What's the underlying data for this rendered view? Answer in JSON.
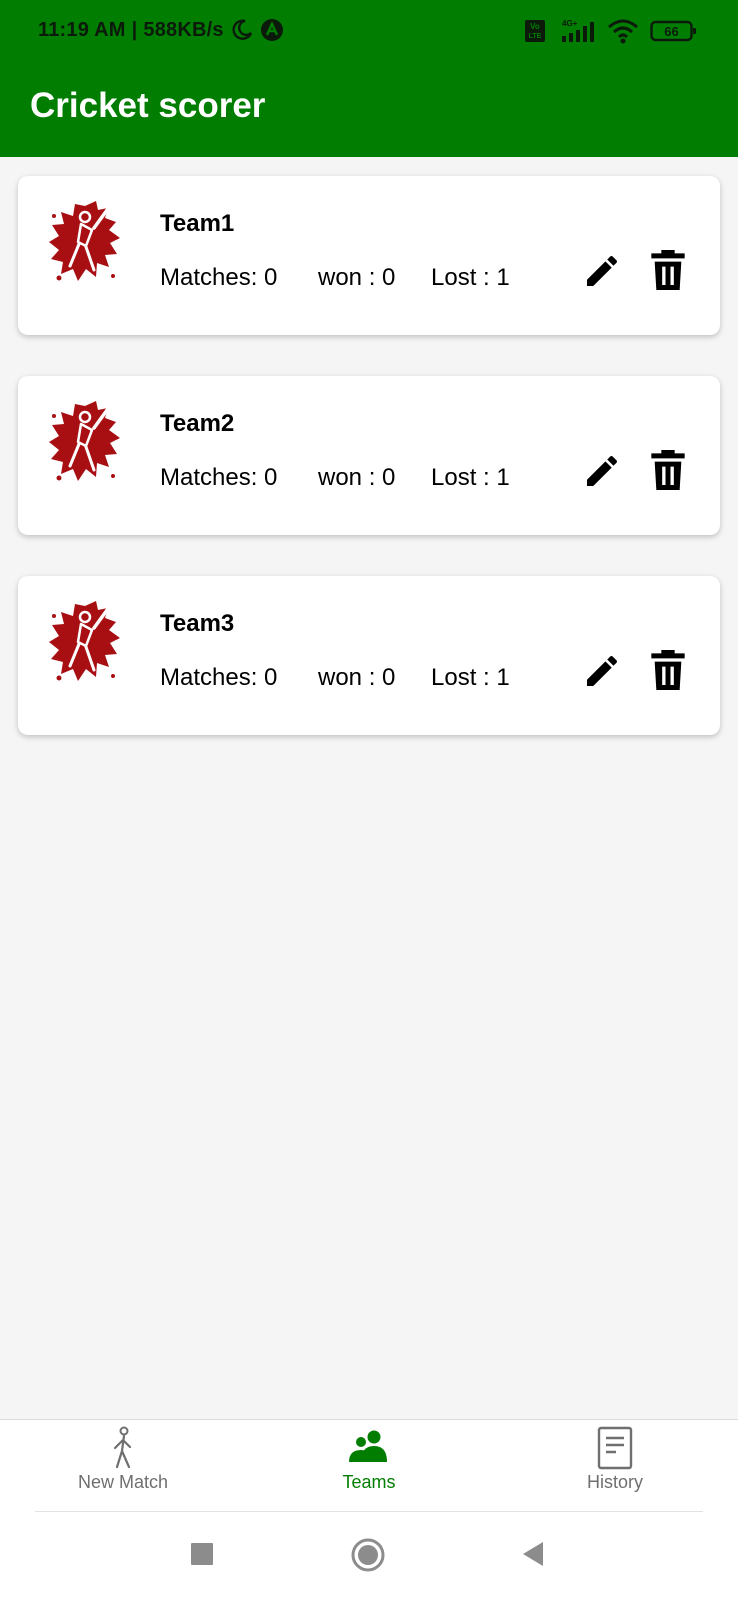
{
  "status_bar": {
    "time": "11:19 AM",
    "separator": "|",
    "network_speed": "588KB/s",
    "battery_level": "66",
    "icons": [
      "moon-icon",
      "app-notification-icon",
      "volte-icon",
      "signal-4g-icon",
      "wifi-icon",
      "battery-icon"
    ]
  },
  "app_bar": {
    "title": "Cricket scorer"
  },
  "teams": [
    {
      "name": "Team1",
      "matches_label": "Matches:",
      "matches": "0",
      "won_label": "won :",
      "won": "0",
      "lost_label": "Lost :",
      "lost": "1"
    },
    {
      "name": "Team2",
      "matches_label": "Matches:",
      "matches": "0",
      "won_label": "won :",
      "won": "0",
      "lost_label": "Lost :",
      "lost": "1"
    },
    {
      "name": "Team3",
      "matches_label": "Matches:",
      "matches": "0",
      "won_label": "won :",
      "won": "0",
      "lost_label": "Lost :",
      "lost": "1"
    }
  ],
  "bottom_nav": {
    "items": [
      {
        "label": "New Match",
        "icon": "walking-person-icon",
        "active": false
      },
      {
        "label": "Teams",
        "icon": "group-icon",
        "active": true
      },
      {
        "label": "History",
        "icon": "document-icon",
        "active": false
      }
    ]
  },
  "system_nav": {
    "icons": [
      "recents-square-icon",
      "home-circle-icon",
      "back-triangle-icon"
    ]
  },
  "colors": {
    "primary": "#017e01",
    "background": "#f5f5f5",
    "card": "#ffffff",
    "logo_red": "#a80f12",
    "nav_inactive": "#6f6f6f"
  }
}
